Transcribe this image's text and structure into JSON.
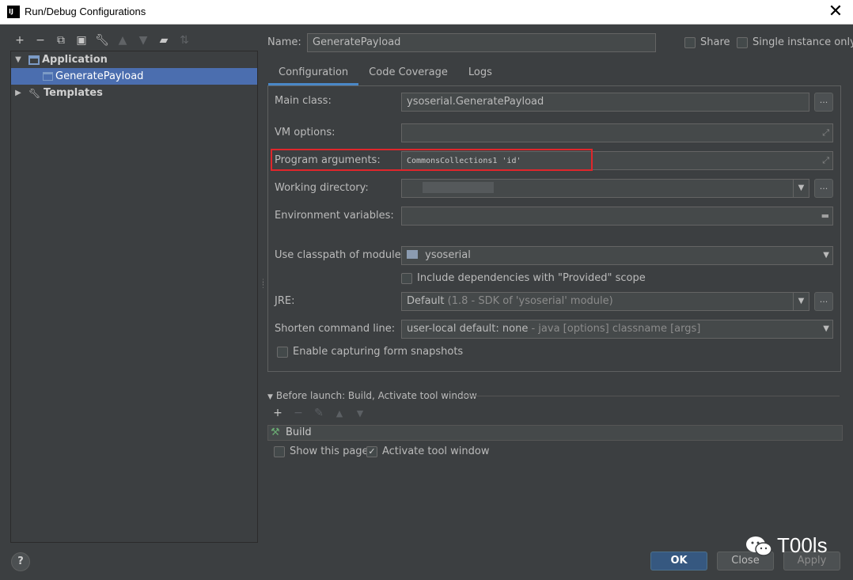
{
  "window": {
    "title": "Run/Debug Configurations",
    "app_icon_text": "IJ"
  },
  "left": {
    "toolbar": [
      "add-icon",
      "remove-icon",
      "copy-icon",
      "save-icon",
      "wrench-icon",
      "move-up-icon",
      "move-down-icon",
      "folder-icon",
      "sort-icon"
    ],
    "tree": [
      {
        "label": "Application",
        "expanded": true
      },
      {
        "label": "GeneratePayload",
        "selected": true
      },
      {
        "label": "Templates",
        "expanded": false
      }
    ]
  },
  "header": {
    "name_label": "Name:",
    "name_value": "GeneratePayload",
    "share_label": "Share",
    "single_instance_label": "Single instance only"
  },
  "tabs": [
    "Configuration",
    "Code Coverage",
    "Logs"
  ],
  "config": {
    "main_class_label": "Main class:",
    "main_class_value": "ysoserial.GeneratePayload",
    "vm_options_label": "VM options:",
    "program_args_label": "Program arguments:",
    "program_args_value": "CommonsCollections1 'id'",
    "working_dir_label": "Working directory:",
    "env_vars_label": "Environment variables:",
    "classpath_label": "Use classpath of module:",
    "classpath_value": "ysoserial",
    "include_deps_label": "Include dependencies with \"Provided\" scope",
    "jre_label": "JRE:",
    "jre_value_main": "Default",
    "jre_value_detail": "(1.8 - SDK of 'ysoserial' module)",
    "shorten_label": "Shorten command line:",
    "shorten_value_main": "user-local default: none",
    "shorten_value_detail": "- java [options] classname [args]",
    "form_snapshots_label": "Enable capturing form snapshots",
    "dots": "..."
  },
  "before_launch": {
    "header": "Before launch: Build, Activate tool window",
    "items": [
      "Build"
    ],
    "show_page_label": "Show this page",
    "activate_label": "Activate tool window"
  },
  "buttons": {
    "help": "?",
    "ok": "OK",
    "close": "Close",
    "apply": "Apply"
  },
  "watermark": {
    "text": "T00ls"
  }
}
